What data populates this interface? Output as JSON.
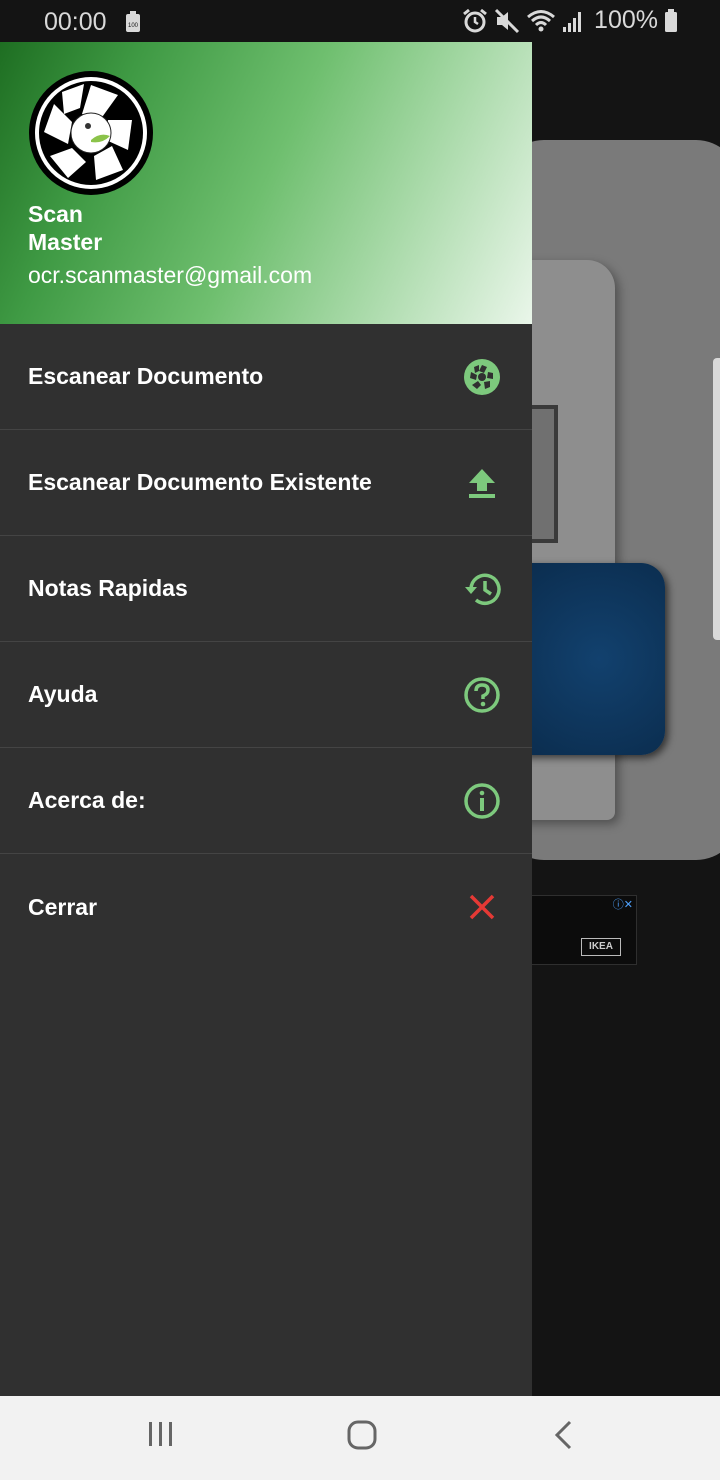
{
  "status_bar": {
    "time": "00:00",
    "battery_small_label": "100",
    "battery_percent": "100%"
  },
  "drawer": {
    "header": {
      "name_line1": "Scan",
      "name_line2": "Master",
      "email": "ocr.scanmaster@gmail.com"
    },
    "menu": [
      {
        "label": "Escanear Documento",
        "icon": "camera-aperture-icon"
      },
      {
        "label": "Escanear Documento Existente",
        "icon": "upload-icon"
      },
      {
        "label": "Notas Rapidas",
        "icon": "history-icon"
      },
      {
        "label": "Ayuda",
        "icon": "help-circle-icon"
      },
      {
        "label": "Acerca de:",
        "icon": "info-circle-icon"
      },
      {
        "label": "Cerrar",
        "icon": "close-icon"
      }
    ]
  },
  "background_ad": {
    "brand": "IKEA"
  },
  "colors": {
    "accent_green": "#7dc97d",
    "close_red": "#e53935",
    "drawer_bg": "#303030"
  }
}
